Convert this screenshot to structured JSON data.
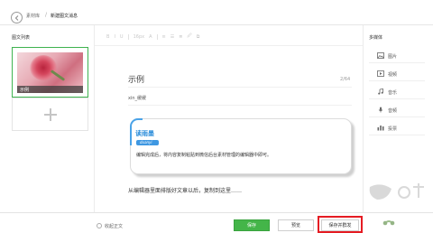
{
  "header": {
    "crumb_root": "素材库",
    "crumb_separator": "/",
    "crumb_current": "新建图文消息"
  },
  "left_panel": {
    "title": "图文列表",
    "items": [
      {
        "caption": "示例"
      }
    ]
  },
  "toolbar": {
    "items": [
      "B",
      "I",
      "U",
      "16px",
      "A",
      "≡",
      "☰",
      "≣",
      "🖉",
      "⧉"
    ]
  },
  "editor": {
    "title": "示例",
    "title_count": "2/64",
    "author": "xin_缓缓",
    "quote": {
      "name": "读雨墨",
      "tag": "duanyi",
      "text": "编辑完成后，将内容复制粘贴到微信后台素材管理的编辑器中即可。"
    },
    "body": "从编辑器里面排版好文章以后，复制到这里……"
  },
  "right_panel": {
    "title": "多媒体",
    "items": [
      {
        "label": "图片",
        "icon": "image-icon"
      },
      {
        "label": "视频",
        "icon": "video-icon"
      },
      {
        "label": "音乐",
        "icon": "music-icon"
      },
      {
        "label": "音频",
        "icon": "microphone-icon"
      },
      {
        "label": "投票",
        "icon": "vote-icon"
      }
    ]
  },
  "footer": {
    "toggle_label": "收起正文",
    "save": "保存",
    "preview": "预览",
    "publish": "保存并群发"
  },
  "colors": {
    "accent_green": "#44b549",
    "highlight_red": "#e51c23",
    "quote_blue": "#3f98e2"
  }
}
